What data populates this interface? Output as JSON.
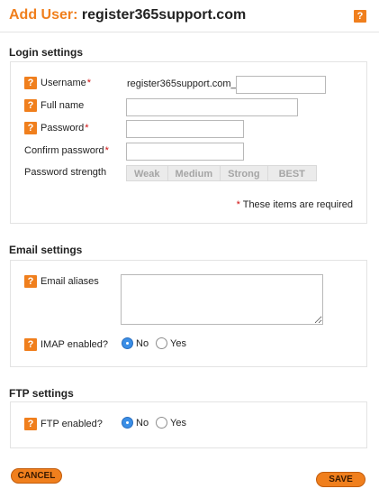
{
  "header": {
    "title_prefix": "Add User:",
    "title_host": "register365support.com",
    "help_glyph": "?"
  },
  "login": {
    "section_title": "Login settings",
    "username_label": "Username",
    "username_prefix": "register365support.com_",
    "username_value": "",
    "fullname_label": "Full name",
    "fullname_value": "",
    "password_label": "Password",
    "password_value": "",
    "confirm_label": "Confirm password",
    "confirm_value": "",
    "strength_label": "Password strength",
    "strength_levels": [
      "Weak",
      "Medium",
      "Strong",
      "BEST"
    ],
    "required_marker": "*",
    "required_note": "These items are required"
  },
  "email": {
    "section_title": "Email settings",
    "aliases_label": "Email aliases",
    "aliases_value": "",
    "imap_label": "IMAP enabled?",
    "no_label": "No",
    "yes_label": "Yes",
    "imap_selected": "No"
  },
  "ftp": {
    "section_title": "FTP settings",
    "ftp_label": "FTP enabled?",
    "no_label": "No",
    "yes_label": "Yes",
    "ftp_selected": "No"
  },
  "buttons": {
    "cancel_label": "CANCEL",
    "save_label": "SAVE"
  },
  "colors": {
    "accent": "#f07f1d",
    "required": "#d01010",
    "radio_selected": "#3a8ee6"
  },
  "icons": [
    "help-icon",
    "radio-selected",
    "radio-unselected"
  ]
}
